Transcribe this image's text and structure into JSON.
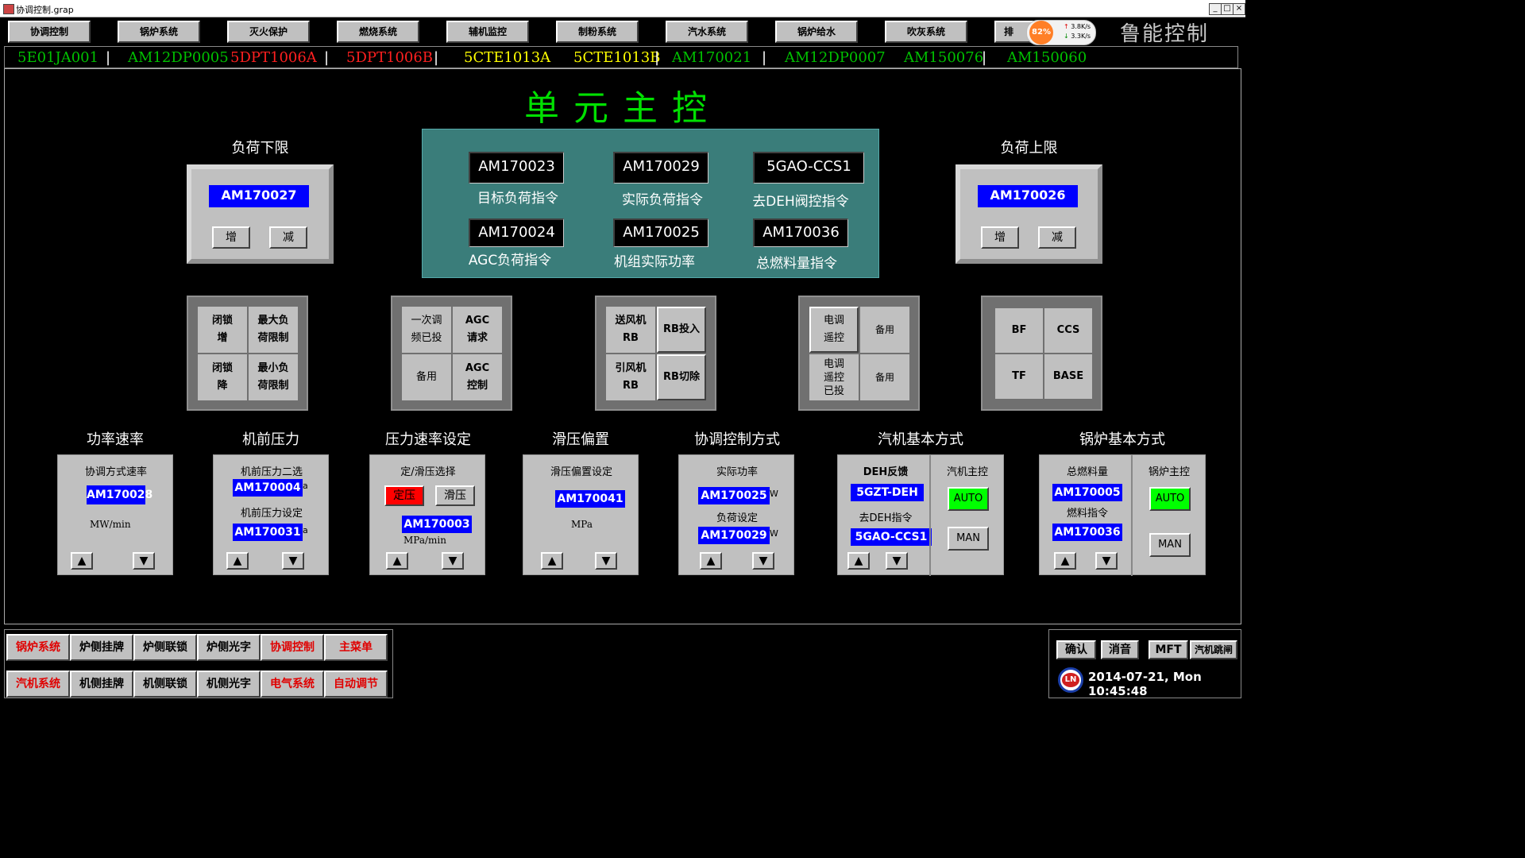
{
  "window": {
    "title": "协调控制.grap",
    "min": "_",
    "max": "□",
    "close": "×"
  },
  "nav": [
    "协调控制",
    "锅炉系统",
    "灭火保护",
    "燃烧系统",
    "辅机监控",
    "制粉系统",
    "汽水系统",
    "锅炉给水",
    "吹灰系统",
    "排"
  ],
  "brand": "鲁能控制",
  "perf": {
    "pct": "82%",
    "up": "3.8K/s",
    "down": "3.3K/s"
  },
  "ticker": [
    {
      "text": "5E01JA001",
      "color": "#00c000"
    },
    {
      "text": "AM12DP0005",
      "color": "#00c000"
    },
    {
      "text": "5DPT1006A",
      "color": "#ff2020"
    },
    {
      "text": "5DPT1006B",
      "color": "#ff2020"
    },
    {
      "text": "5CTE1013A",
      "color": "#ffff00"
    },
    {
      "text": "5CTE1013B",
      "color": "#ffff00"
    },
    {
      "text": "AM170021",
      "color": "#00c000"
    },
    {
      "text": "AM12DP0007",
      "color": "#00c000"
    },
    {
      "text": "AM150076",
      "color": "#00c000"
    },
    {
      "text": "AM150060",
      "color": "#00c000"
    }
  ],
  "main_title": "单元主控",
  "load_low": {
    "title": "负荷下限",
    "value": "AM170027",
    "inc": "增",
    "dec": "减"
  },
  "load_high": {
    "title": "负荷上限",
    "value": "AM170026",
    "inc": "增",
    "dec": "减"
  },
  "center": [
    {
      "value": "AM170023",
      "label": "目标负荷指令"
    },
    {
      "value": "AM170029",
      "label": "实际负荷指令"
    },
    {
      "value": "5GAO-CCS1",
      "label": "去DEH阀控指令"
    },
    {
      "value": "AM170024",
      "label": "AGC负荷指令"
    },
    {
      "value": "AM170025",
      "label": "机组实际功率"
    },
    {
      "value": "AM170036",
      "label": "总燃料量指令"
    }
  ],
  "grid1": [
    "闭锁\n增",
    "最大负\n荷限制",
    "闭锁\n降",
    "最小负\n荷限制"
  ],
  "grid2": [
    "一次调\n频已投",
    "AGC\n请求",
    "备用",
    "AGC\n控制"
  ],
  "grid3": [
    "送风机\nRB",
    "RB投入",
    "引风机\nRB",
    "RB切除"
  ],
  "grid4": [
    "电调\n遥控",
    "备用",
    "电调\n遥控\n已投",
    "备用"
  ],
  "grid5": [
    "BF",
    "CCS",
    "TF",
    "BASE"
  ],
  "panels": {
    "p1": {
      "title": "功率速率",
      "sub": "协调方式速率",
      "value": "AM170028",
      "unit": "MW/min"
    },
    "p2": {
      "title": "机前压力",
      "sub1": "机前压力二选",
      "v1": "AM170004",
      "sub2": "机前压力设定",
      "v2": "AM170031",
      "u": "a"
    },
    "p3": {
      "title": "压力速率设定",
      "sub": "定/滑压选择",
      "b1": "定压",
      "b2": "滑压",
      "value": "AM170003",
      "unit": "MPa/min"
    },
    "p4": {
      "title": "滑压偏置",
      "sub": "滑压偏置设定",
      "value": "AM170041",
      "unit": "MPa"
    },
    "p5": {
      "title": "协调控制方式",
      "sub1": "实际功率",
      "v1": "AM170025",
      "sub2": "负荷设定",
      "v2": "AM170029",
      "u": "W"
    },
    "p6": {
      "title": "汽机基本方式",
      "sub1": "DEH反馈",
      "v1": "5GZT-DEH",
      "sub2": "去DEH指令",
      "v2": "5GAO-CCS1",
      "ctl": "汽机主控",
      "auto": "AUTO",
      "man": "MAN"
    },
    "p7": {
      "title": "锅炉基本方式",
      "sub1": "总燃料量",
      "v1": "AM170005",
      "sub2": "燃料指令",
      "v2": "AM170036",
      "ctl": "锅炉主控",
      "auto": "AUTO",
      "man": "MAN"
    }
  },
  "arrows": {
    "up": "▲",
    "down": "▼"
  },
  "bottom_row1": [
    {
      "text": "锅炉系统",
      "color": "#e00000"
    },
    {
      "text": "炉侧挂牌",
      "color": "#000"
    },
    {
      "text": "炉侧联锁",
      "color": "#000"
    },
    {
      "text": "炉侧光字",
      "color": "#000"
    },
    {
      "text": "协调控制",
      "color": "#e00000"
    },
    {
      "text": "主菜单",
      "color": "#e00000"
    }
  ],
  "bottom_row2": [
    {
      "text": "汽机系统",
      "color": "#e00000"
    },
    {
      "text": "机侧挂牌",
      "color": "#000"
    },
    {
      "text": "机侧联锁",
      "color": "#000"
    },
    {
      "text": "机侧光字",
      "color": "#000"
    },
    {
      "text": "电气系统",
      "color": "#e00000"
    },
    {
      "text": "自动调节",
      "color": "#e00000"
    }
  ],
  "alarm": {
    "ack": "确认",
    "mute": "消音",
    "mft": "MFT",
    "trip": "汽机跳闸"
  },
  "datetime": "2014-07-21, Mon 10:45:48",
  "logo": "LN"
}
